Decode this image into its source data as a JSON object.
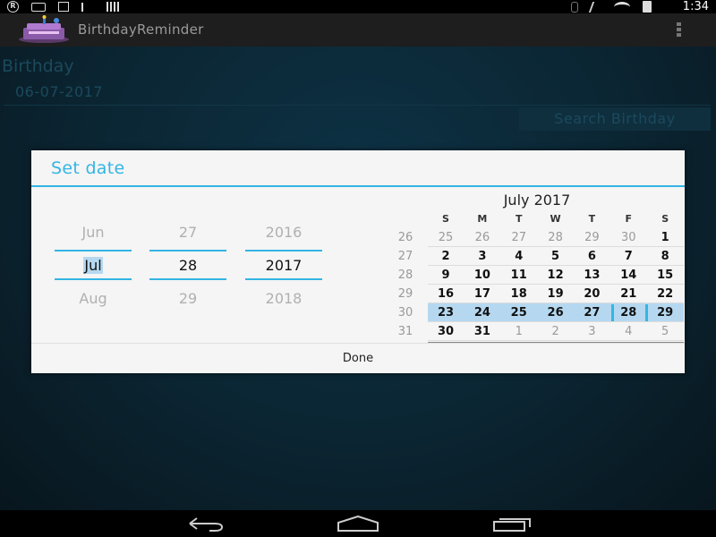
{
  "status_bar": {
    "time": "1:34",
    "left_icons": [
      "registered-icon",
      "message-icon",
      "download-icon",
      "flag-icon",
      "signal-bars-icon"
    ],
    "right_icons": [
      "bluetooth-icon",
      "mute-icon",
      "wifi-icon",
      "battery-icon"
    ]
  },
  "action_bar": {
    "title": "BirthdayReminder",
    "logo": "birthday-cake-icon",
    "menu_icon": "overflow-menu-icon"
  },
  "form": {
    "label": "Birthday",
    "date_value": "06-07-2017",
    "search_button": "Search Birthday"
  },
  "dialog": {
    "title": "Set date",
    "done_label": "Done",
    "accent_color": "#33b5e5",
    "spinners": {
      "month": {
        "prev": "Jun",
        "current": "Jul",
        "next": "Aug"
      },
      "day": {
        "prev": "27",
        "current": "28",
        "next": "29"
      },
      "year": {
        "prev": "2016",
        "current": "2017",
        "next": "2018"
      }
    },
    "calendar": {
      "title": "July 2017",
      "day_names": [
        "S",
        "M",
        "T",
        "W",
        "T",
        "F",
        "S"
      ],
      "weeks": [
        {
          "num": "26",
          "days": [
            "25",
            "26",
            "27",
            "28",
            "29",
            "30",
            "1"
          ],
          "other": [
            0,
            1,
            2,
            3,
            4,
            5
          ]
        },
        {
          "num": "27",
          "days": [
            "2",
            "3",
            "4",
            "5",
            "6",
            "7",
            "8"
          ],
          "other": []
        },
        {
          "num": "28",
          "days": [
            "9",
            "10",
            "11",
            "12",
            "13",
            "14",
            "15"
          ],
          "other": []
        },
        {
          "num": "29",
          "days": [
            "16",
            "17",
            "18",
            "19",
            "20",
            "21",
            "22"
          ],
          "other": []
        },
        {
          "num": "30",
          "days": [
            "23",
            "24",
            "25",
            "26",
            "27",
            "28",
            "29"
          ],
          "other": [],
          "highlight": true,
          "selected_day_index": 5
        },
        {
          "num": "31",
          "days": [
            "30",
            "31",
            "1",
            "2",
            "3",
            "4",
            "5"
          ],
          "other": [
            2,
            3,
            4,
            5,
            6
          ]
        }
      ]
    }
  },
  "nav_bar": {
    "icons": [
      "back-icon",
      "home-icon",
      "recent-apps-icon"
    ]
  }
}
